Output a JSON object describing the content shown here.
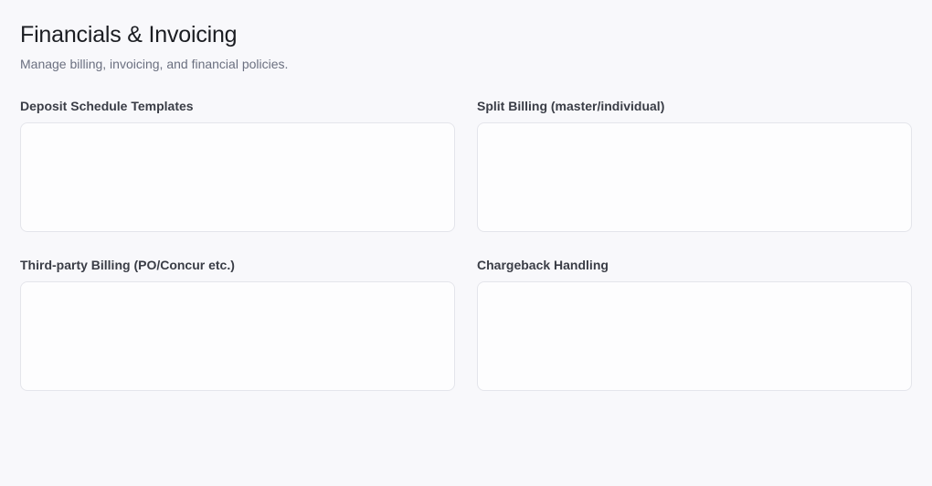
{
  "header": {
    "title": "Financials & Invoicing",
    "subtitle": "Manage billing, invoicing, and financial policies."
  },
  "fields": [
    {
      "label": "Deposit Schedule Templates",
      "value": "",
      "placeholder": ""
    },
    {
      "label": "Split Billing (master/individual)",
      "value": "",
      "placeholder": ""
    },
    {
      "label": "Third-party Billing (PO/Concur etc.)",
      "value": "",
      "placeholder": ""
    },
    {
      "label": "Chargeback Handling",
      "value": "",
      "placeholder": ""
    }
  ]
}
